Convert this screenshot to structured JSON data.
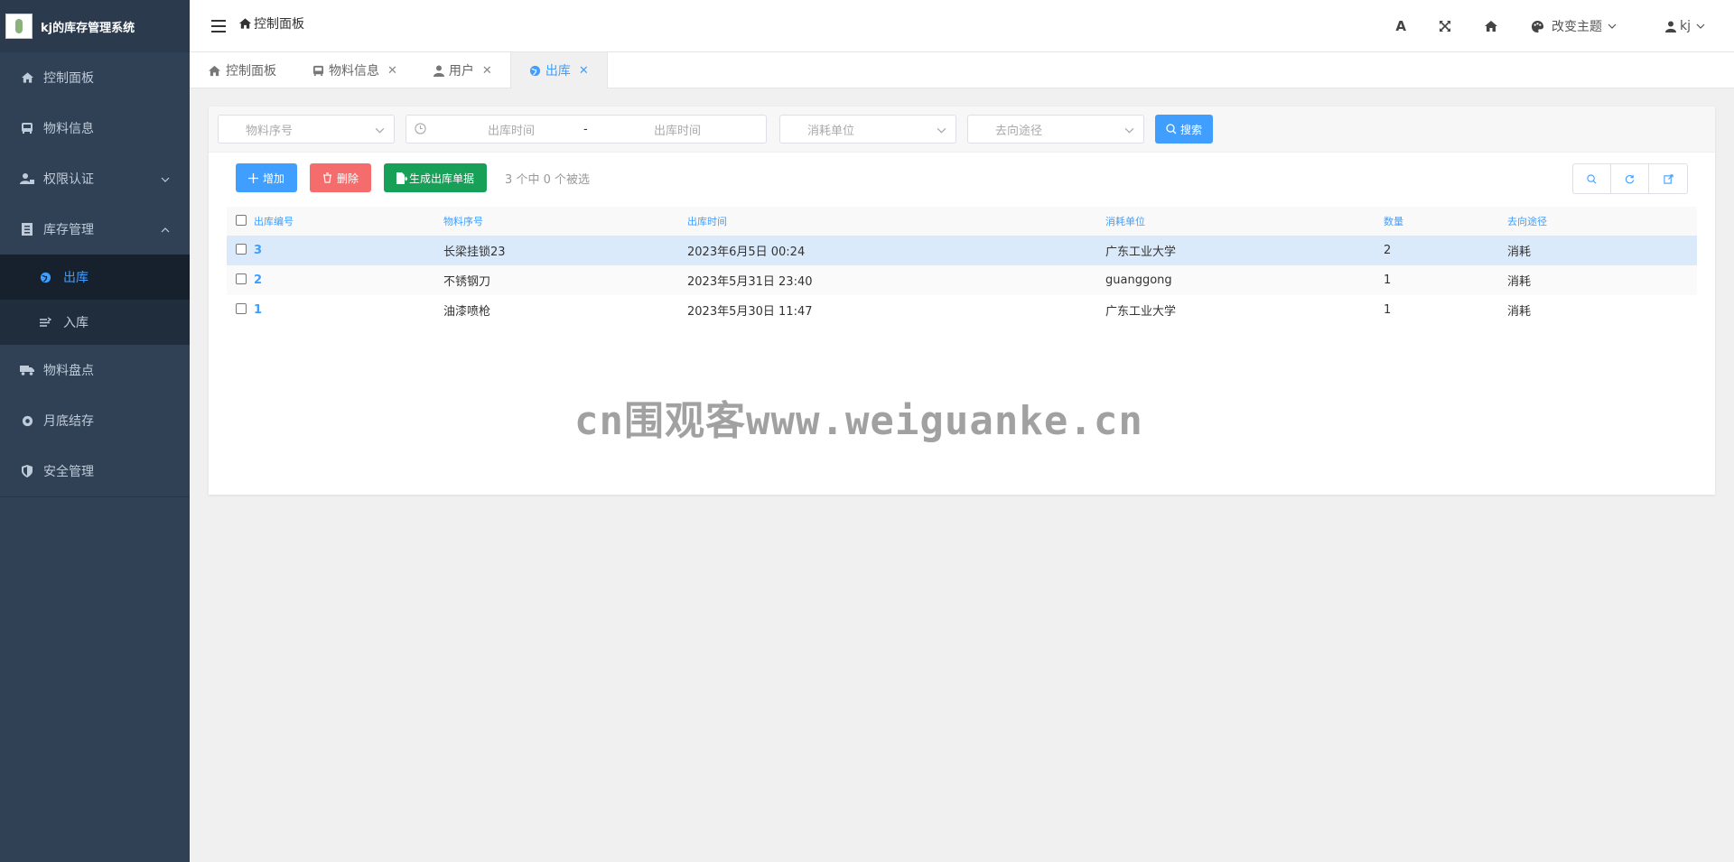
{
  "app": {
    "title": "kj的库存管理系统"
  },
  "sidebar": {
    "items": [
      {
        "label": "控制面板",
        "icon": "home-icon"
      },
      {
        "label": "物料信息",
        "icon": "bus-icon"
      },
      {
        "label": "权限认证",
        "icon": "user-lock-icon"
      },
      {
        "label": "库存管理",
        "icon": "warehouse-icon"
      },
      {
        "label": "物料盘点",
        "icon": "truck-icon"
      },
      {
        "label": "月底结存",
        "icon": "coin-icon"
      },
      {
        "label": "安全管理",
        "icon": "shield-icon"
      }
    ],
    "sub_items": [
      {
        "label": "出库",
        "icon": "globe-icon"
      },
      {
        "label": "入库",
        "icon": "import-icon"
      }
    ]
  },
  "header": {
    "breadcrumb": "控制面板",
    "theme_label": "改变主题",
    "user_label": "kj"
  },
  "tabs": [
    {
      "label": "控制面板"
    },
    {
      "label": "物料信息"
    },
    {
      "label": "用户"
    },
    {
      "label": "出库"
    }
  ],
  "filters": {
    "material_placeholder": "物料序号",
    "date_start_placeholder": "出库时间",
    "date_sep": "-",
    "date_end_placeholder": "出库时间",
    "unit_placeholder": "消耗单位",
    "dest_placeholder": "去向途径",
    "search_label": "搜索"
  },
  "toolbar": {
    "add_label": "增加",
    "delete_label": "删除",
    "generate_label": "生成出库单据",
    "selection_info": "3 个中 0 个被选"
  },
  "table": {
    "headers": [
      "出库编号",
      "物料序号",
      "出库时间",
      "消耗单位",
      "数量",
      "去向途径"
    ],
    "rows": [
      [
        "3",
        "长梁挂锁23",
        "2023年6月5日 00:24",
        "广东工业大学",
        "2",
        "消耗"
      ],
      [
        "2",
        "不锈钢刀",
        "2023年5月31日 23:40",
        "guanggong",
        "1",
        "消耗"
      ],
      [
        "1",
        "油漆喷枪",
        "2023年5月30日 11:47",
        "广东工业大学",
        "1",
        "消耗"
      ]
    ]
  },
  "watermark": "cn围观客www.weiguanke.cn",
  "colors": {
    "primary": "#409eff",
    "danger": "#f56c6c",
    "success": "#18a058",
    "sidebar": "#304156"
  }
}
